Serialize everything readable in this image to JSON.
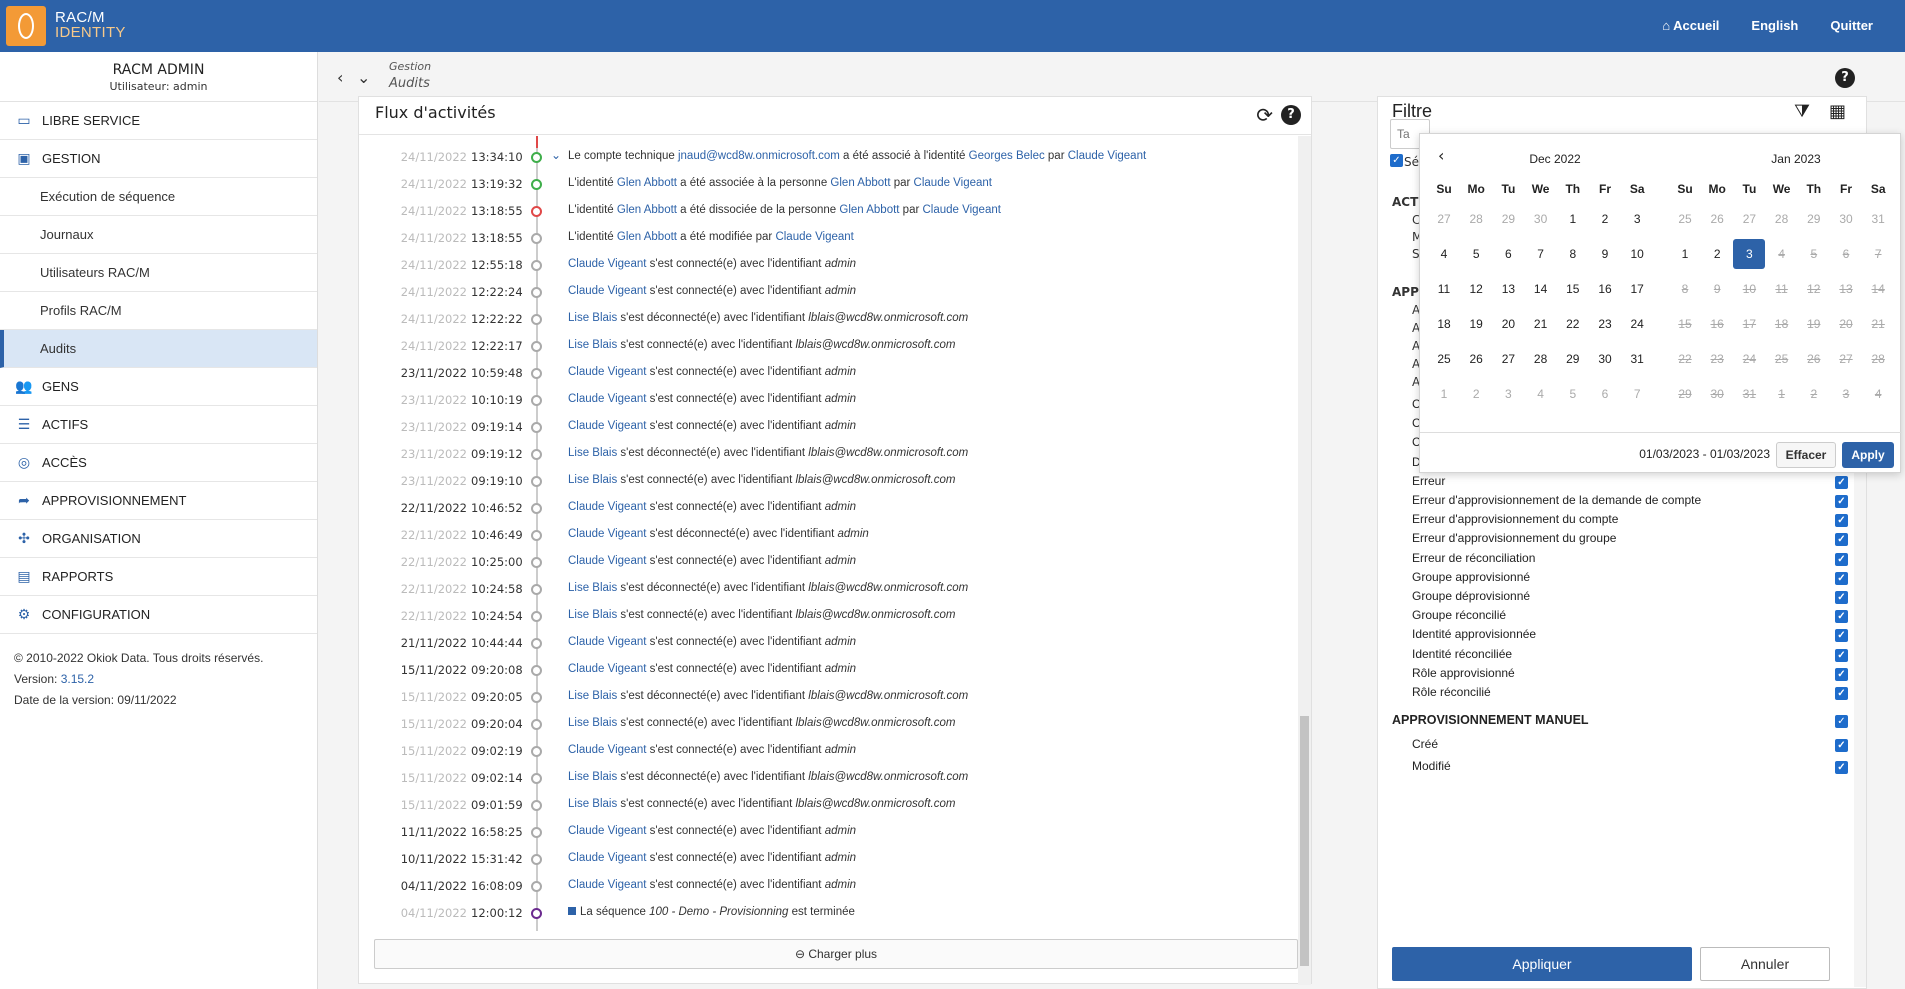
{
  "app": {
    "logo_line1": "RAC/M",
    "logo_line2": "IDENTITY"
  },
  "topnav": {
    "home": "Accueil",
    "language": "English",
    "quit": "Quitter"
  },
  "user": {
    "name": "RACM ADMIN",
    "subtitle": "Utilisateur: admin"
  },
  "sidebar": {
    "libre_service": "LIBRE SERVICE",
    "gestion": "GESTION",
    "sub": [
      "Exécution de séquence",
      "Journaux",
      "Utilisateurs RAC/M",
      "Profils RAC/M",
      "Audits"
    ],
    "gens": "GENS",
    "actifs": "ACTIFS",
    "acces": "ACCÈS",
    "approvisionnement": "APPROVISIONNEMENT",
    "organisation": "ORGANISATION",
    "rapports": "RAPPORTS",
    "configuration": "CONFIGURATION"
  },
  "footer": {
    "copyright": "© 2010-2022 Okiok Data. Tous droits réservés.",
    "version_label": "Version: ",
    "version": "3.15.2",
    "release_date": "Date de la version: 09/11/2022"
  },
  "breadcrumb": {
    "parent": "Gestion",
    "current": "Audits"
  },
  "activity": {
    "title": "Flux d'activités",
    "load_more": "Charger plus",
    "rows": [
      {
        "date": "24/11/2022",
        "time": "13:34:10",
        "status": "g",
        "expand": true,
        "parts": [
          [
            "t",
            "Le compte technique "
          ],
          [
            "l",
            "jnaud@wcd8w.onmicrosoft.com"
          ],
          [
            "t",
            " a été associé à l'identité "
          ],
          [
            "l",
            "Georges Belec"
          ],
          [
            "t",
            " par "
          ],
          [
            "l",
            "Claude Vigeant"
          ]
        ]
      },
      {
        "date": "24/11/2022",
        "time": "13:19:32",
        "status": "g",
        "parts": [
          [
            "t",
            "L'identité "
          ],
          [
            "l",
            "Glen Abbott"
          ],
          [
            "t",
            " a été associée à la personne "
          ],
          [
            "l",
            "Glen Abbott"
          ],
          [
            "t",
            " par "
          ],
          [
            "l",
            "Claude Vigeant"
          ]
        ]
      },
      {
        "date": "24/11/2022",
        "time": "13:18:55",
        "status": "r",
        "parts": [
          [
            "t",
            "L'identité "
          ],
          [
            "l",
            "Glen Abbott"
          ],
          [
            "t",
            " a été dissociée de la personne "
          ],
          [
            "l",
            "Glen Abbott"
          ],
          [
            "t",
            " par "
          ],
          [
            "l",
            "Claude Vigeant"
          ]
        ]
      },
      {
        "date": "24/11/2022",
        "time": "13:18:55",
        "status": "n",
        "parts": [
          [
            "t",
            "L'identité "
          ],
          [
            "l",
            "Glen Abbott"
          ],
          [
            "t",
            " a été modifiée par "
          ],
          [
            "l",
            "Claude Vigeant"
          ]
        ]
      },
      {
        "date": "24/11/2022",
        "time": "12:55:18",
        "status": "n",
        "parts": [
          [
            "l",
            "Claude Vigeant"
          ],
          [
            "t",
            " s'est connecté(e) avec l'identifiant "
          ],
          [
            "i",
            "admin"
          ]
        ]
      },
      {
        "date": "24/11/2022",
        "time": "12:22:24",
        "status": "n",
        "parts": [
          [
            "l",
            "Claude Vigeant"
          ],
          [
            "t",
            " s'est connecté(e) avec l'identifiant "
          ],
          [
            "i",
            "admin"
          ]
        ]
      },
      {
        "date": "24/11/2022",
        "time": "12:22:22",
        "status": "n",
        "parts": [
          [
            "l",
            "Lise Blais"
          ],
          [
            "t",
            " s'est déconnecté(e) avec l'identifiant "
          ],
          [
            "i",
            "lblais@wcd8w.onmicrosoft.com"
          ]
        ]
      },
      {
        "date": "24/11/2022",
        "time": "12:22:17",
        "status": "n",
        "parts": [
          [
            "l",
            "Lise Blais"
          ],
          [
            "t",
            " s'est connecté(e) avec l'identifiant "
          ],
          [
            "i",
            "lblais@wcd8w.onmicrosoft.com"
          ]
        ]
      },
      {
        "date": "23/11/2022",
        "time": "10:59:48",
        "status": "n",
        "dark": true,
        "parts": [
          [
            "l",
            "Claude Vigeant"
          ],
          [
            "t",
            " s'est connecté(e) avec l'identifiant "
          ],
          [
            "i",
            "admin"
          ]
        ]
      },
      {
        "date": "23/11/2022",
        "time": "10:10:19",
        "status": "n",
        "parts": [
          [
            "l",
            "Claude Vigeant"
          ],
          [
            "t",
            " s'est connecté(e) avec l'identifiant "
          ],
          [
            "i",
            "admin"
          ]
        ]
      },
      {
        "date": "23/11/2022",
        "time": "09:19:14",
        "status": "n",
        "parts": [
          [
            "l",
            "Claude Vigeant"
          ],
          [
            "t",
            " s'est connecté(e) avec l'identifiant "
          ],
          [
            "i",
            "admin"
          ]
        ]
      },
      {
        "date": "23/11/2022",
        "time": "09:19:12",
        "status": "n",
        "parts": [
          [
            "l",
            "Lise Blais"
          ],
          [
            "t",
            " s'est déconnecté(e) avec l'identifiant "
          ],
          [
            "i",
            "lblais@wcd8w.onmicrosoft.com"
          ]
        ]
      },
      {
        "date": "23/11/2022",
        "time": "09:19:10",
        "status": "n",
        "parts": [
          [
            "l",
            "Lise Blais"
          ],
          [
            "t",
            " s'est connecté(e) avec l'identifiant "
          ],
          [
            "i",
            "lblais@wcd8w.onmicrosoft.com"
          ]
        ]
      },
      {
        "date": "22/11/2022",
        "time": "10:46:52",
        "status": "n",
        "dark": true,
        "parts": [
          [
            "l",
            "Claude Vigeant"
          ],
          [
            "t",
            " s'est connecté(e) avec l'identifiant "
          ],
          [
            "i",
            "admin"
          ]
        ]
      },
      {
        "date": "22/11/2022",
        "time": "10:46:49",
        "status": "n",
        "parts": [
          [
            "l",
            "Claude Vigeant"
          ],
          [
            "t",
            " s'est déconnecté(e) avec l'identifiant "
          ],
          [
            "i",
            "admin"
          ]
        ]
      },
      {
        "date": "22/11/2022",
        "time": "10:25:00",
        "status": "n",
        "parts": [
          [
            "l",
            "Claude Vigeant"
          ],
          [
            "t",
            " s'est connecté(e) avec l'identifiant "
          ],
          [
            "i",
            "admin"
          ]
        ]
      },
      {
        "date": "22/11/2022",
        "time": "10:24:58",
        "status": "n",
        "parts": [
          [
            "l",
            "Lise Blais"
          ],
          [
            "t",
            " s'est déconnecté(e) avec l'identifiant "
          ],
          [
            "i",
            "lblais@wcd8w.onmicrosoft.com"
          ]
        ]
      },
      {
        "date": "22/11/2022",
        "time": "10:24:54",
        "status": "n",
        "parts": [
          [
            "l",
            "Lise Blais"
          ],
          [
            "t",
            " s'est connecté(e) avec l'identifiant "
          ],
          [
            "i",
            "lblais@wcd8w.onmicrosoft.com"
          ]
        ]
      },
      {
        "date": "21/11/2022",
        "time": "10:44:44",
        "status": "n",
        "dark": true,
        "parts": [
          [
            "l",
            "Claude Vigeant"
          ],
          [
            "t",
            " s'est connecté(e) avec l'identifiant "
          ],
          [
            "i",
            "admin"
          ]
        ]
      },
      {
        "date": "15/11/2022",
        "time": "09:20:08",
        "status": "n",
        "dark": true,
        "parts": [
          [
            "l",
            "Claude Vigeant"
          ],
          [
            "t",
            " s'est connecté(e) avec l'identifiant "
          ],
          [
            "i",
            "admin"
          ]
        ]
      },
      {
        "date": "15/11/2022",
        "time": "09:20:05",
        "status": "n",
        "parts": [
          [
            "l",
            "Lise Blais"
          ],
          [
            "t",
            " s'est déconnecté(e) avec l'identifiant "
          ],
          [
            "i",
            "lblais@wcd8w.onmicrosoft.com"
          ]
        ]
      },
      {
        "date": "15/11/2022",
        "time": "09:20:04",
        "status": "n",
        "parts": [
          [
            "l",
            "Lise Blais"
          ],
          [
            "t",
            " s'est connecté(e) avec l'identifiant "
          ],
          [
            "i",
            "lblais@wcd8w.onmicrosoft.com"
          ]
        ]
      },
      {
        "date": "15/11/2022",
        "time": "09:02:19",
        "status": "n",
        "parts": [
          [
            "l",
            "Claude Vigeant"
          ],
          [
            "t",
            " s'est connecté(e) avec l'identifiant "
          ],
          [
            "i",
            "admin"
          ]
        ]
      },
      {
        "date": "15/11/2022",
        "time": "09:02:14",
        "status": "n",
        "parts": [
          [
            "l",
            "Lise Blais"
          ],
          [
            "t",
            " s'est déconnecté(e) avec l'identifiant "
          ],
          [
            "i",
            "lblais@wcd8w.onmicrosoft.com"
          ]
        ]
      },
      {
        "date": "15/11/2022",
        "time": "09:01:59",
        "status": "n",
        "parts": [
          [
            "l",
            "Lise Blais"
          ],
          [
            "t",
            " s'est connecté(e) avec l'identifiant "
          ],
          [
            "i",
            "lblais@wcd8w.onmicrosoft.com"
          ]
        ]
      },
      {
        "date": "11/11/2022",
        "time": "16:58:25",
        "status": "n",
        "dark": true,
        "parts": [
          [
            "l",
            "Claude Vigeant"
          ],
          [
            "t",
            " s'est connecté(e) avec l'identifiant "
          ],
          [
            "i",
            "admin"
          ]
        ]
      },
      {
        "date": "10/11/2022",
        "time": "15:31:42",
        "status": "n",
        "dark": true,
        "parts": [
          [
            "l",
            "Claude Vigeant"
          ],
          [
            "t",
            " s'est connecté(e) avec l'identifiant "
          ],
          [
            "i",
            "admin"
          ]
        ]
      },
      {
        "date": "04/11/2022",
        "time": "16:08:09",
        "status": "n",
        "dark": true,
        "parts": [
          [
            "l",
            "Claude Vigeant"
          ],
          [
            "t",
            " s'est connecté(e) avec l'identifiant "
          ],
          [
            "i",
            "admin"
          ]
        ]
      },
      {
        "date": "04/11/2022",
        "time": "12:00:12",
        "status": "p",
        "square": true,
        "parts": [
          [
            "t",
            "La séquence "
          ],
          [
            "i",
            "100 - Demo - Provisionning"
          ],
          [
            "t",
            " est terminée"
          ]
        ]
      }
    ]
  },
  "filter": {
    "title": "Filtre",
    "search_placeholder": "Ta",
    "partial_labels": [
      "Sé",
      "ACT",
      "C",
      "M",
      "S",
      "APP",
      "A",
      "A",
      "A",
      "A",
      "A"
    ],
    "items": [
      "Compte approvisionné",
      "Compte déprovisionné",
      "Compte réconcilié",
      "Demande écrite approvisionnée",
      "Erreur",
      "Erreur d'approvisionnement de la demande de compte",
      "Erreur d'approvisionnement du compte",
      "Erreur d'approvisionnement du groupe",
      "Erreur de réconciliation",
      "Groupe approvisionné",
      "Groupe déprovisionné",
      "Groupe réconcilié",
      "Identité approvisionnée",
      "Identité réconciliée",
      "Rôle approvisionné",
      "Rôle réconcilié"
    ],
    "manual_section": "APPROVISIONNEMENT MANUEL",
    "manual_items": [
      "Créé",
      "Modifié"
    ],
    "apply": "Appliquer",
    "cancel": "Annuler"
  },
  "calendar": {
    "month1": "Dec 2022",
    "month2": "Jan 2023",
    "weekdays": [
      "Su",
      "Mo",
      "Tu",
      "We",
      "Th",
      "Fr",
      "Sa"
    ],
    "month1_days": [
      "27",
      "28",
      "29",
      "30",
      "1",
      "2",
      "3",
      "4",
      "5",
      "6",
      "7",
      "8",
      "9",
      "10",
      "11",
      "12",
      "13",
      "14",
      "15",
      "16",
      "17",
      "18",
      "19",
      "20",
      "21",
      "22",
      "23",
      "24",
      "25",
      "26",
      "27",
      "28",
      "29",
      "30",
      "31",
      "1",
      "2",
      "3",
      "4",
      "5",
      "6",
      "7"
    ],
    "month2_days": [
      "25",
      "26",
      "27",
      "28",
      "29",
      "30",
      "31",
      "1",
      "2",
      "3",
      "4",
      "5",
      "6",
      "7",
      "8",
      "9",
      "10",
      "11",
      "12",
      "13",
      "14",
      "15",
      "16",
      "17",
      "18",
      "19",
      "20",
      "21",
      "22",
      "23",
      "24",
      "25",
      "26",
      "27",
      "28",
      "29",
      "30",
      "31",
      "1",
      "2",
      "3",
      "4"
    ],
    "range": "01/03/2023 - 01/03/2023",
    "clear": "Effacer",
    "apply": "Apply"
  }
}
